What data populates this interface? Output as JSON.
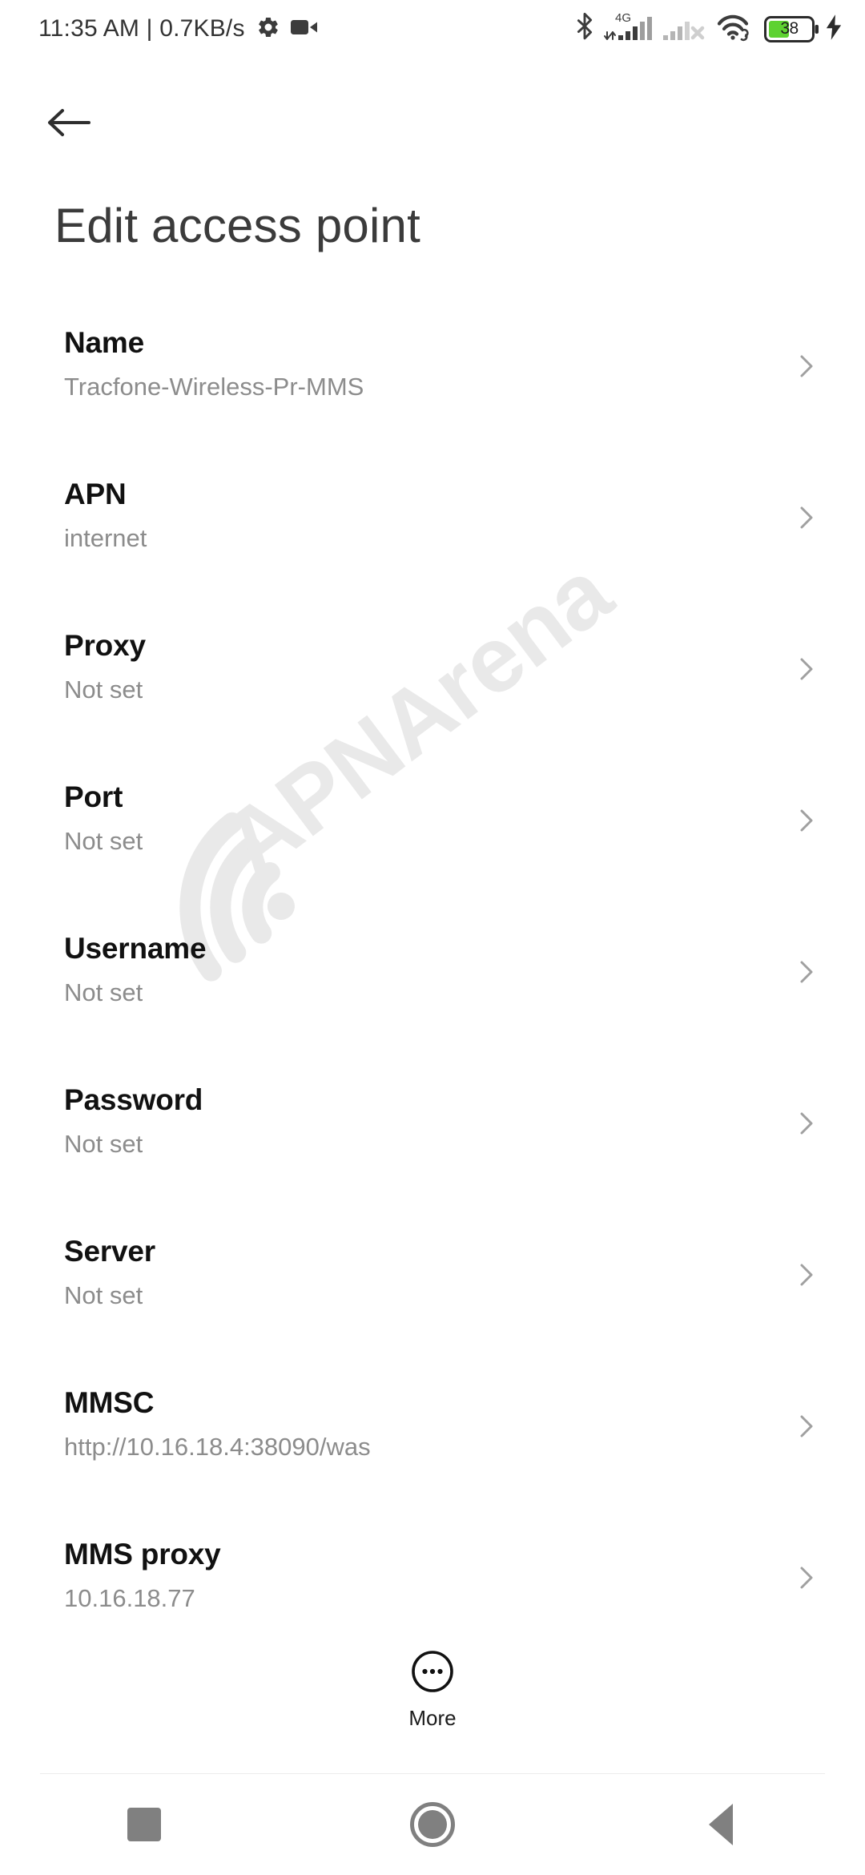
{
  "statusbar": {
    "clock": "11:35 AM | 0.7KB/s",
    "network_label": "4G",
    "battery_percent": "38",
    "icons": {
      "settings": "gear-icon",
      "screen_recorder": "video-camera-icon",
      "bluetooth": "bluetooth-icon",
      "signal_sim1": "signal-bars-4g-icon",
      "signal_sim2": "signal-bars-no-service-icon",
      "wifi": "wifi-linked-icon",
      "battery": "battery-icon",
      "charging": "charging-bolt-icon"
    },
    "colors": {
      "text": "#333333",
      "battery_fill": "#5ed231"
    }
  },
  "header": {
    "back_label": "Back",
    "title": "Edit access point"
  },
  "watermark": {
    "text": "APNArena",
    "color": "#e9e9e9"
  },
  "list": {
    "items": [
      {
        "title": "Name",
        "value": "Tracfone-Wireless-Pr-MMS"
      },
      {
        "title": "APN",
        "value": "internet"
      },
      {
        "title": "Proxy",
        "value": "Not set"
      },
      {
        "title": "Port",
        "value": "Not set"
      },
      {
        "title": "Username",
        "value": "Not set"
      },
      {
        "title": "Password",
        "value": "Not set"
      },
      {
        "title": "Server",
        "value": "Not set"
      },
      {
        "title": "MMSC",
        "value": "http://10.16.18.4:38090/was"
      },
      {
        "title": "MMS proxy",
        "value": "10.16.18.77"
      }
    ]
  },
  "more_button": {
    "label": "More"
  },
  "navbar": {
    "recents_label": "Recents",
    "home_label": "Home",
    "back_label": "Back"
  }
}
